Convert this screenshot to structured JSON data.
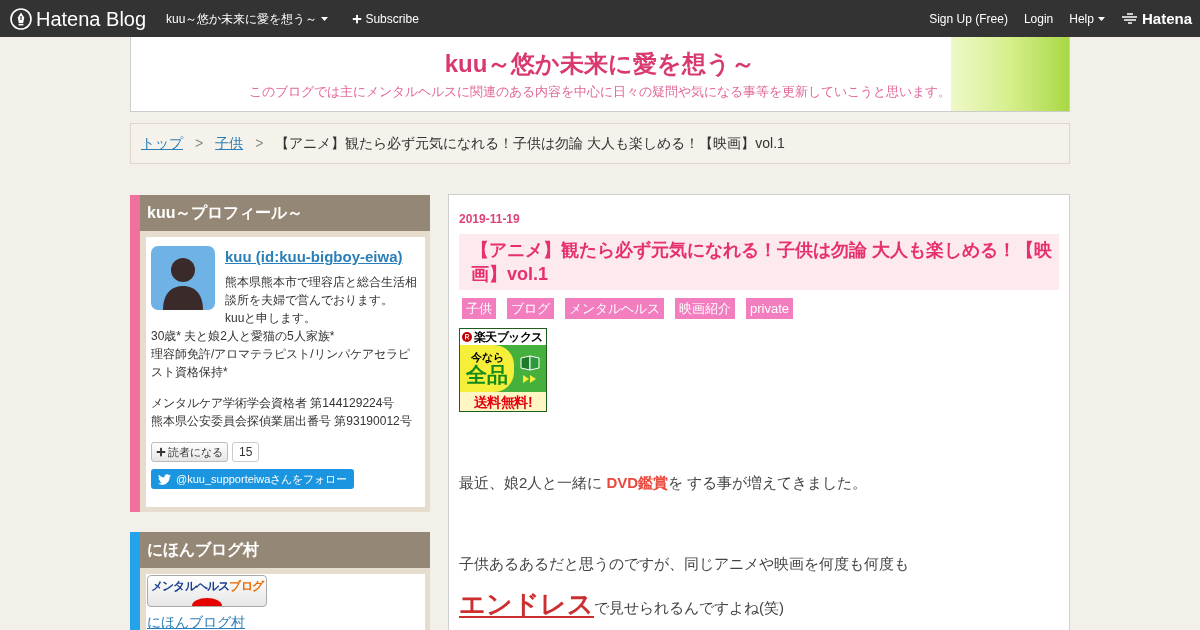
{
  "top_bar": {
    "logo": "Hatena Blog",
    "blog_menu": "kuu～悠か未来に愛を想う～",
    "subscribe": "Subscribe",
    "links": [
      {
        "label": "Sign Up (Free)",
        "kind": "link"
      },
      {
        "label": "Login",
        "kind": "link"
      },
      {
        "label": "Help",
        "kind": "menu"
      }
    ],
    "brand": "Hatena"
  },
  "header": {
    "title": "kuu～悠か未来に愛を想う～",
    "description": "このブログでは主にメンタルヘルスに関連のある内容を中心に日々の疑問や気になる事等を更新していこうと思います。"
  },
  "breadcrumb": [
    {
      "kind": "link",
      "label": "トップ"
    },
    {
      "kind": "separator",
      "label": ">"
    },
    {
      "kind": "link",
      "label": "子供"
    },
    {
      "kind": "separator",
      "label": ">"
    },
    {
      "kind": "current",
      "label": "【アニメ】観たら必ず元気になれる！子供は勿論 大人も楽しめる！【映画】vol.1"
    }
  ],
  "sidebar": {
    "modules": [
      {
        "kind": "profile",
        "color": "#f0719e",
        "title": "kuu～プロフィール～",
        "name_link": "kuu (id:kuu-bigboy-eiwa)",
        "intro": [
          "熊本県熊本市で理容店と総合生活相談所を夫婦で営んでおります。",
          "kuuと申します。"
        ],
        "bio": [
          "30歳* 夫と娘2人と愛猫の5人家族*",
          "理容師免許/アロマテラピスト/リンパケアセラピスト資格保持*"
        ],
        "credentials": [
          "メンタルケア学術学会資格者 第144129224号",
          "熊本県公安委員会探偵業届出番号 第93190012号"
        ],
        "reader_button": "読者になる",
        "reader_count": "15",
        "twitter_follow": "@kuu_supporteiwaさんをフォロー"
      },
      {
        "kind": "banner",
        "color": "#25a2ec",
        "title": "にほんブログ村",
        "banner": {
          "label": "メンタルヘルス",
          "accent": "ブログ"
        },
        "link": "にほんブログ村"
      }
    ]
  },
  "article": {
    "date": "2019-11-19",
    "title": "【アニメ】観たら必ず元気になれる！子供は勿論 大人も楽しめる！【映画】vol.1",
    "categories": [
      "子供",
      "ブログ",
      "メンタルヘルス",
      "映画紹介",
      "private"
    ],
    "ad": {
      "brand": "楽天ブックス",
      "line_1": "今なら",
      "headline": "全品",
      "offer": "送料無料!"
    },
    "body": [
      {
        "parts": [
          {
            "kind": "plain",
            "text": "最近、娘2人と一緒に "
          },
          {
            "kind": "emphasis",
            "text": "DVD鑑賞"
          },
          {
            "kind": "plain",
            "text": "を する事が増えてきました。"
          }
        ]
      },
      {
        "parts": [
          {
            "kind": "plain",
            "text": "子供あるあるだと思うのですが、同じアニメや映画を何度も何度も"
          }
        ]
      },
      {
        "parts": [
          {
            "kind": "large",
            "text": "エンドレス"
          },
          {
            "kind": "plain",
            "text": "で見せられるんですよね(笑)"
          }
        ]
      }
    ]
  }
}
